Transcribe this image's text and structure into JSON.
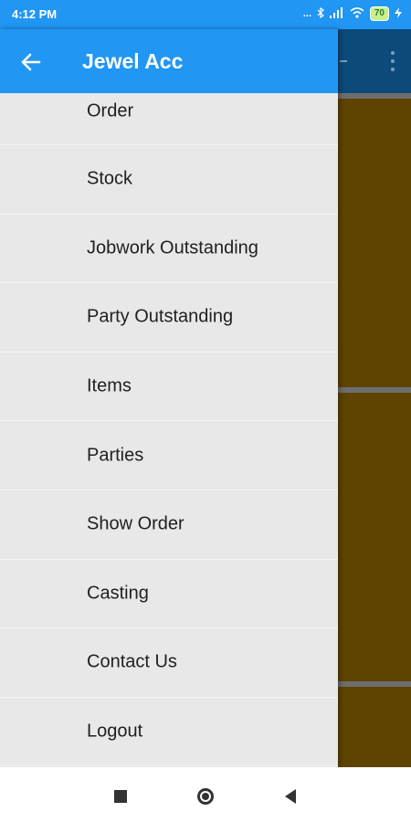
{
  "status_bar": {
    "time": "4:12 PM",
    "icons_text": "...",
    "battery": "70"
  },
  "drawer": {
    "title": "Jewel Acc",
    "items": [
      {
        "label": "Order"
      },
      {
        "label": "Stock"
      },
      {
        "label": "Jobwork Outstanding"
      },
      {
        "label": "Party Outstanding"
      },
      {
        "label": "Items"
      },
      {
        "label": "Parties"
      },
      {
        "label": "Show Order"
      },
      {
        "label": "Casting"
      },
      {
        "label": "Contact Us"
      },
      {
        "label": "Logout"
      }
    ]
  },
  "colors": {
    "primary": "#2196f3",
    "drawer_bg": "#e8e8e8",
    "background_content": "#5f4300",
    "background_appbar": "#0d4a7c"
  },
  "icons": {
    "back": "arrow-left-icon",
    "nav_recents": "square-icon",
    "nav_home": "circle-icon",
    "nav_back": "triangle-left-icon"
  }
}
